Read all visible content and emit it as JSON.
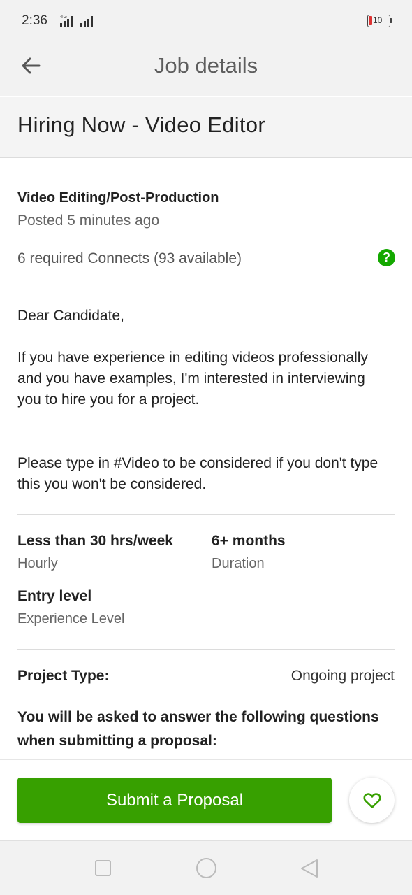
{
  "status_bar": {
    "time": "2:36",
    "network": "4G",
    "battery": "10"
  },
  "app_bar": {
    "back_icon": "arrow-left-icon",
    "title": "Job details"
  },
  "job": {
    "title": "Hiring Now - Video Editor",
    "category": "Video Editing/Post-Production",
    "posted": "Posted 5 minutes ago",
    "connects": "6 required Connects (93 available)",
    "help_icon": "?",
    "description": [
      "Dear Candidate,",
      "If you have experience in editing videos professionally and you have examples, I'm interested in interviewing you to hire you for a project.",
      "Please type in #Video to be considered if you don't type this you won't be considered."
    ],
    "stats": [
      {
        "value": "Less than 30 hrs/week",
        "label": "Hourly"
      },
      {
        "value": "6+ months",
        "label": "Duration"
      },
      {
        "value": "Entry level",
        "label": "Experience Level"
      }
    ],
    "project_type_label": "Project Type:",
    "project_type_value": "Ongoing project",
    "questions_note": "You will be asked to answer the following questions when submitting a proposal:"
  },
  "actions": {
    "submit_label": "Submit a Proposal",
    "save_icon": "heart-icon"
  },
  "colors": {
    "accent": "#37a000",
    "help": "#14a800"
  }
}
